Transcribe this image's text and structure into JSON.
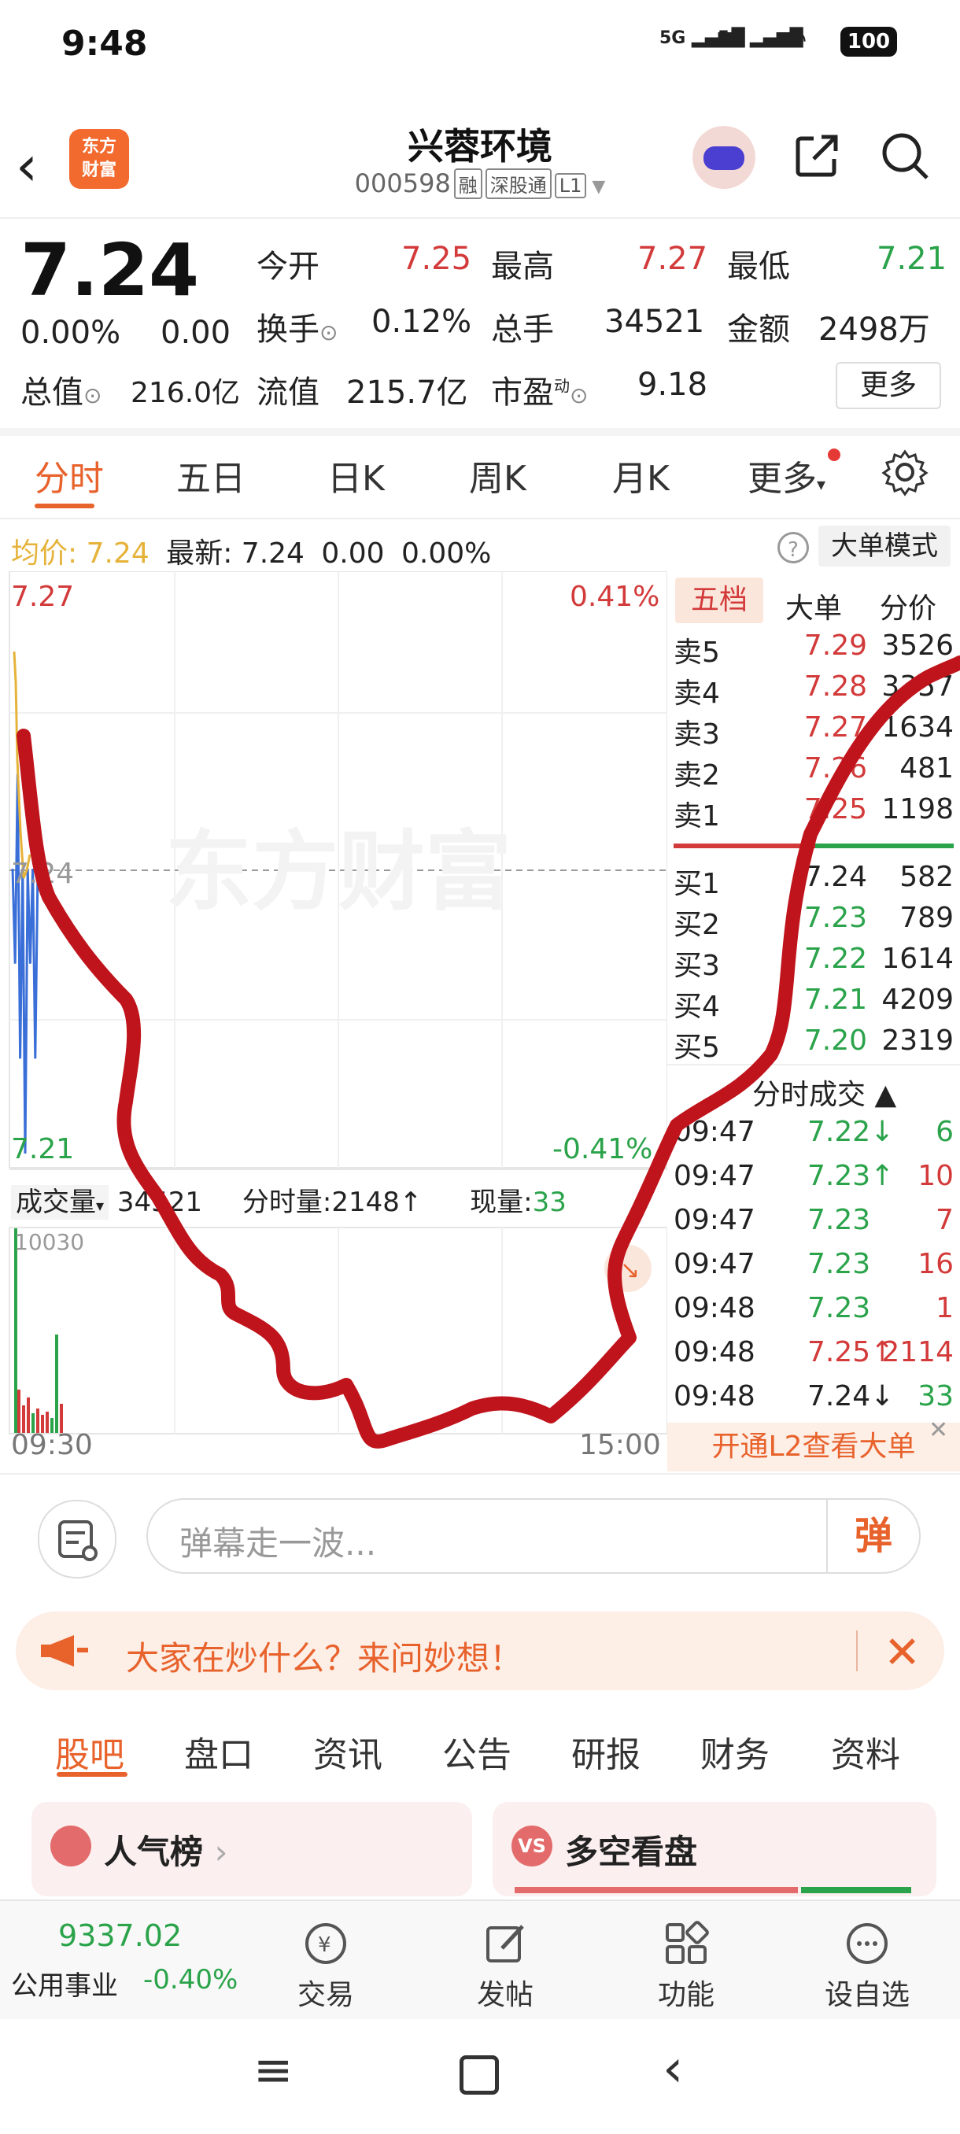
{
  "status": {
    "time": "9:48",
    "net1": "5G",
    "net2": "5G",
    "battery": "100"
  },
  "header": {
    "logo_line1": "东方",
    "logo_line2": "财富",
    "stock_name": "兴蓉环境",
    "code": "000598",
    "tag1": "融",
    "tag2": "深股通",
    "tag3": "L1"
  },
  "quote": {
    "price": "7.24",
    "change_pct": "0.00%",
    "change": "0.00",
    "open_label": "今开",
    "open": "7.25",
    "high_label": "最高",
    "high": "7.27",
    "low_label": "最低",
    "low": "7.21",
    "turnover_label": "换手",
    "turnover": "0.12%",
    "volume_label": "总手",
    "volume": "34521",
    "amount_label": "金额",
    "amount": "2498万",
    "mktcap_label": "总值",
    "mktcap": "216.0亿",
    "float_label": "流值",
    "float": "215.7亿",
    "pe_label": "市盈",
    "pe_sup": "动",
    "pe": "9.18",
    "more": "更多"
  },
  "tabs": [
    "分时",
    "五日",
    "日K",
    "周K",
    "月K",
    "更多"
  ],
  "info": {
    "avg_label": "均价",
    "avg": "7.24",
    "latest_label": "最新",
    "latest": "7.24",
    "chg": "0.00",
    "chg_pct": "0.00%",
    "big_mode": "大单模式"
  },
  "chart": {
    "y_top": "7.27",
    "y_mid": "7.24",
    "y_bot": "7.21",
    "pct_top": "0.41%",
    "pct_bot": "-0.41%",
    "time_start": "09:30",
    "time_end": "15:00",
    "vol_max": "10030",
    "watermark": "东方财富"
  },
  "chart_data": {
    "type": "line",
    "series": [
      {
        "values": [
          7.24,
          7.23,
          7.25,
          7.22,
          7.24,
          7.21,
          7.24,
          7.23,
          7.24,
          7.22,
          7.24
        ]
      }
    ],
    "ylim": [
      7.21,
      7.27
    ]
  },
  "vol_bar": {
    "label": "成交量",
    "total": "34521",
    "min_label": "分时量",
    "min_value": "2148",
    "now_label": "现量",
    "now_value": "33"
  },
  "orderbook": {
    "tabs": [
      "五档",
      "大单",
      "分价"
    ],
    "asks": [
      {
        "label": "卖5",
        "price": "7.29",
        "vol": "3526"
      },
      {
        "label": "卖4",
        "price": "7.28",
        "vol": "3357"
      },
      {
        "label": "卖3",
        "price": "7.27",
        "vol": "1634"
      },
      {
        "label": "卖2",
        "price": "7.26",
        "vol": "481"
      },
      {
        "label": "卖1",
        "price": "7.25",
        "vol": "1198"
      }
    ],
    "bids": [
      {
        "label": "买1",
        "price": "7.24",
        "vol": "582"
      },
      {
        "label": "买2",
        "price": "7.23",
        "vol": "789"
      },
      {
        "label": "买3",
        "price": "7.22",
        "vol": "1614"
      },
      {
        "label": "买4",
        "price": "7.21",
        "vol": "4209"
      },
      {
        "label": "买5",
        "price": "7.20",
        "vol": "2319"
      }
    ],
    "trades_title": "分时成交",
    "trades": [
      {
        "time": "09:47",
        "price": "7.22↓",
        "vol": "6"
      },
      {
        "time": "09:47",
        "price": "7.23↑",
        "vol": "10"
      },
      {
        "time": "09:47",
        "price": "7.23",
        "vol": "7"
      },
      {
        "time": "09:47",
        "price": "7.23",
        "vol": "16"
      },
      {
        "time": "09:48",
        "price": "7.23",
        "vol": "1"
      },
      {
        "time": "09:48",
        "price": "7.25↑",
        "vol": "2114"
      },
      {
        "time": "09:48",
        "price": "7.24↓",
        "vol": "33"
      }
    ],
    "l2_banner": "开通L2查看大单"
  },
  "comment": {
    "placeholder": "弹幕走一波...",
    "danmu": "弹"
  },
  "ask_banner": {
    "text": "大家在炒什么？来问妙想！"
  },
  "sub_tabs": [
    "股吧",
    "盘口",
    "资讯",
    "公告",
    "研报",
    "财务",
    "资料"
  ],
  "cards": {
    "left": "人气榜",
    "right": "多空看盘"
  },
  "bottom": {
    "index_value": "9337.02",
    "index_name": "公用事业",
    "index_change": "-0.40%",
    "items": [
      "交易",
      "发帖",
      "功能",
      "设自选"
    ]
  },
  "colors": {
    "accent": "#e8622c",
    "up": "#d33a3a",
    "down": "#2aa34a",
    "annotation": "#c0141c"
  }
}
